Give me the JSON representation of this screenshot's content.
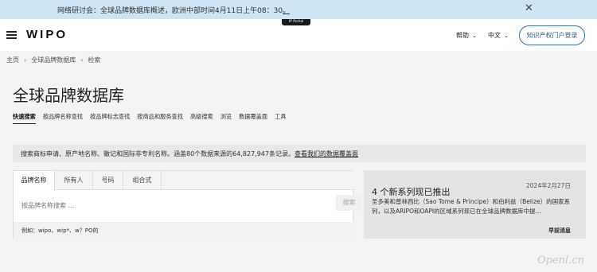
{
  "banner": {
    "text": "网络研讨会：全球品牌数据库概述，欧洲中部时间4月11日上午08：30",
    "link": "。",
    "close_icon": "close-icon"
  },
  "header": {
    "logo": "WIPO",
    "ip_portal_badge": "IP Portal",
    "help_label": "帮助",
    "language_label": "中文",
    "login_label": "知识产权门户登录",
    "menu_icon": "hamburger-icon"
  },
  "breadcrumb": {
    "items": [
      "主页",
      "全球品牌数据库",
      "检索"
    ]
  },
  "page": {
    "title": "全球品牌数据库"
  },
  "nav_tabs": [
    {
      "label": "快速搜索",
      "active": true
    },
    {
      "label": "按品牌名称查找",
      "active": false
    },
    {
      "label": "按品牌标志查找",
      "active": false
    },
    {
      "label": "按商品和服务查找",
      "active": false
    },
    {
      "label": "高级搜索",
      "active": false
    },
    {
      "label": "浏览",
      "active": false
    },
    {
      "label": "数据覆盖面",
      "active": false
    },
    {
      "label": "工具",
      "active": false
    }
  ],
  "info": {
    "text": "搜索商标申请、原产地名称、徽记和国际非专利名称。涵盖80个数据来源的64,827,947条记录。",
    "link": "查看我们的数据覆盖面"
  },
  "search": {
    "tabs": [
      "品牌名称",
      "所有人",
      "号码",
      "组合式"
    ],
    "active_tab": "品牌名称",
    "placeholder": "按品牌名称搜索 ...",
    "button_label": "搜索",
    "example": "例如：wipo、wip*、w？PO的"
  },
  "news": {
    "date": "2024年2月27日",
    "title": "4 个新系列现已推出",
    "body": "圣多美和普林西比（Sao Tome & Principe）和伯利兹（Belize）的国家系列，以及ARIPO和OAPI的区域系列现已在全球品牌数据库中提...",
    "more_label": "早前消息"
  },
  "watermark": "Openl.cn"
}
